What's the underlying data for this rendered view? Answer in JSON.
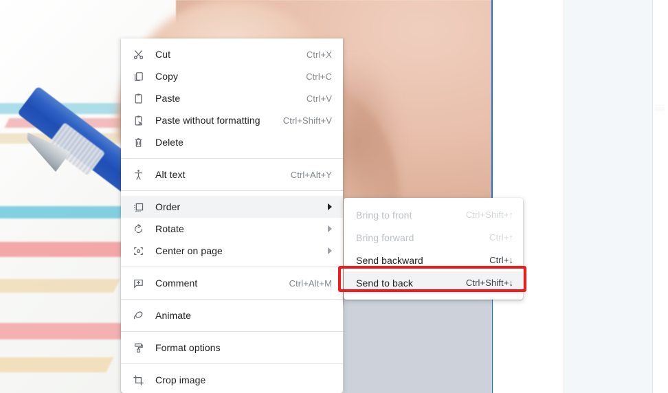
{
  "colors": {
    "menu_bg": "#ffffff",
    "text": "#202124",
    "accel": "#80868b",
    "disabled": "#bdc1c6",
    "hover": "#f1f3f4",
    "selection_blue": "#1a73e8",
    "highlight_red": "#f01c1c",
    "shape_gray": "#ccd1da",
    "side_panel": "#f3f7f9"
  },
  "context_menu": {
    "name": "image-context-menu",
    "groups": [
      {
        "items": [
          {
            "icon": "cut-icon",
            "label": "Cut",
            "accel": "Ctrl+X",
            "state": "enabled",
            "submenu": false
          },
          {
            "icon": "copy-icon",
            "label": "Copy",
            "accel": "Ctrl+C",
            "state": "enabled",
            "submenu": false
          },
          {
            "icon": "paste-icon",
            "label": "Paste",
            "accel": "Ctrl+V",
            "state": "enabled",
            "submenu": false
          },
          {
            "icon": "paste-without-formatting-icon",
            "label": "Paste without formatting",
            "accel": "Ctrl+Shift+V",
            "state": "enabled",
            "submenu": false
          },
          {
            "icon": "delete-icon",
            "label": "Delete",
            "accel": "",
            "state": "enabled",
            "submenu": false
          }
        ]
      },
      {
        "items": [
          {
            "icon": "alt-text-icon",
            "label": "Alt text",
            "accel": "Ctrl+Alt+Y",
            "state": "enabled",
            "submenu": false
          }
        ]
      },
      {
        "items": [
          {
            "icon": "order-icon",
            "label": "Order",
            "accel": "",
            "state": "hovered",
            "submenu": true
          },
          {
            "icon": "rotate-icon",
            "label": "Rotate",
            "accel": "",
            "state": "enabled",
            "submenu": true
          },
          {
            "icon": "center-on-page-icon",
            "label": "Center on page",
            "accel": "",
            "state": "enabled",
            "submenu": true
          }
        ]
      },
      {
        "items": [
          {
            "icon": "comment-icon",
            "label": "Comment",
            "accel": "Ctrl+Alt+M",
            "state": "enabled",
            "submenu": false
          }
        ]
      },
      {
        "items": [
          {
            "icon": "animate-icon",
            "label": "Animate",
            "accel": "",
            "state": "enabled",
            "submenu": false
          }
        ]
      },
      {
        "items": [
          {
            "icon": "format-options-icon",
            "label": "Format options",
            "accel": "",
            "state": "enabled",
            "submenu": false
          }
        ]
      },
      {
        "items": [
          {
            "icon": "crop-image-icon",
            "label": "Crop image",
            "accel": "",
            "state": "enabled",
            "submenu": false
          }
        ]
      }
    ]
  },
  "order_submenu": {
    "name": "order-submenu",
    "items": [
      {
        "label": "Bring to front",
        "accel": "Ctrl+Shift+↑",
        "state": "disabled"
      },
      {
        "label": "Bring forward",
        "accel": "Ctrl+↑",
        "state": "disabled"
      },
      {
        "label": "Send backward",
        "accel": "Ctrl+↓",
        "state": "enabled"
      },
      {
        "label": "Send to back",
        "accel": "Ctrl+Shift+↓",
        "state": "highlighted"
      }
    ]
  },
  "canvas": {
    "selected_object": "photo-image",
    "secondary_object": "gray-rectangle-shape"
  }
}
